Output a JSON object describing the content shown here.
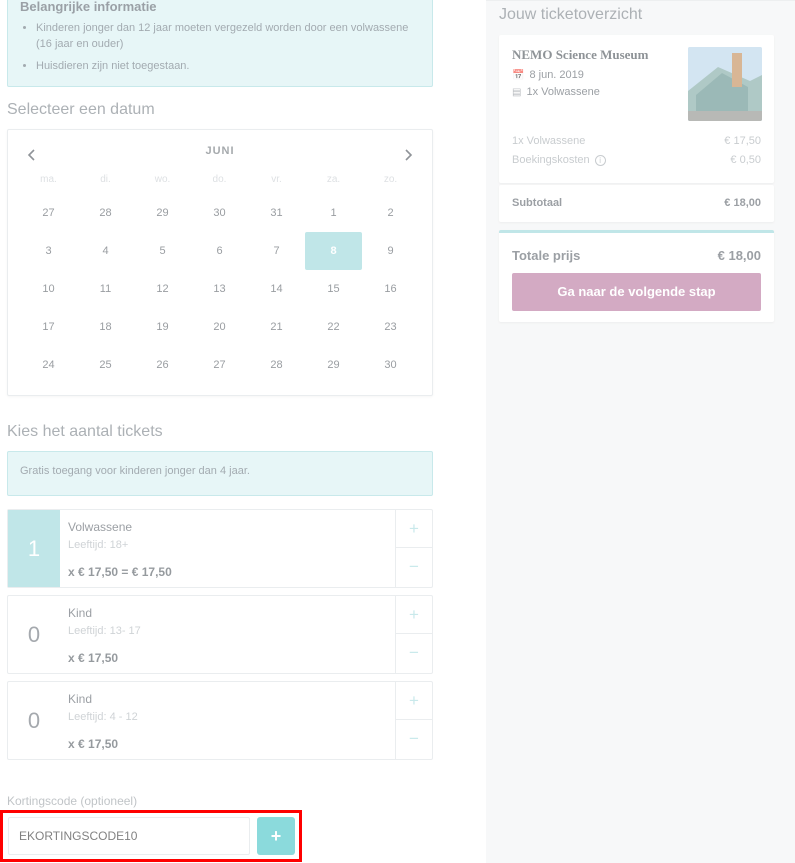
{
  "info": {
    "title": "Belangrijke informatie",
    "items": [
      "Kinderen jonger dan 12 jaar moeten vergezeld worden door een volwassene (16 jaar en ouder)",
      "Huisdieren zijn niet toegestaan."
    ]
  },
  "date_section": {
    "title": "Selecteer een datum",
    "month": "JUNI",
    "weekdays": [
      "ma.",
      "di.",
      "wo.",
      "do.",
      "vr.",
      "za.",
      "zo."
    ],
    "days": [
      "27",
      "28",
      "29",
      "30",
      "31",
      "1",
      "2",
      "3",
      "4",
      "5",
      "6",
      "7",
      "8",
      "9",
      "10",
      "11",
      "12",
      "13",
      "14",
      "15",
      "16",
      "17",
      "18",
      "19",
      "20",
      "21",
      "22",
      "23",
      "24",
      "25",
      "26",
      "27",
      "28",
      "29",
      "30"
    ],
    "selected_day": "8"
  },
  "tickets_section": {
    "title": "Kies het aantal tickets",
    "notice": "Gratis toegang voor kinderen jonger dan 4 jaar.",
    "tickets": [
      {
        "qty": "1",
        "name": "Volwassene",
        "age": "Leeftijd: 18+",
        "price": "x € 17,50 = € 17,50"
      },
      {
        "qty": "0",
        "name": "Kind",
        "age": "Leeftijd: 13- 17",
        "price": "x € 17,50"
      },
      {
        "qty": "0",
        "name": "Kind",
        "age": "Leeftijd: 4 - 12",
        "price": "x € 17,50"
      }
    ],
    "plus": "+",
    "minus": "−"
  },
  "discount": {
    "label": "Kortingscode (optioneel)",
    "value": "EKORTINGSCODE10",
    "button": "+"
  },
  "overview": {
    "title": "Jouw ticketoverzicht",
    "museum": "NEMO Science Museum",
    "date": "8 jun. 2019",
    "ticket_summary": "1x Volwassene",
    "lines": [
      {
        "label": "1x Volwassene",
        "amount": "€ 17,50"
      },
      {
        "label": "Boekingskosten",
        "amount": "€ 0,50"
      }
    ],
    "subtotal_label": "Subtotaal",
    "subtotal_amount": "€ 18,00",
    "total_label": "Totale prijs",
    "total_amount": "€ 18,00",
    "next_button": "Ga naar de volgende stap"
  },
  "colors": {
    "teal_light": "#d9f1f2",
    "teal_selected": "#9ad7da",
    "teal_button": "#45c3c7",
    "next_button": "#b8779f",
    "highlight": "#ff0000"
  },
  "icons": {
    "prev": "chevron-left-icon",
    "next": "chevron-right-icon",
    "calendar": "calendar-icon",
    "ticket": "ticket-icon",
    "info": "info-icon"
  }
}
